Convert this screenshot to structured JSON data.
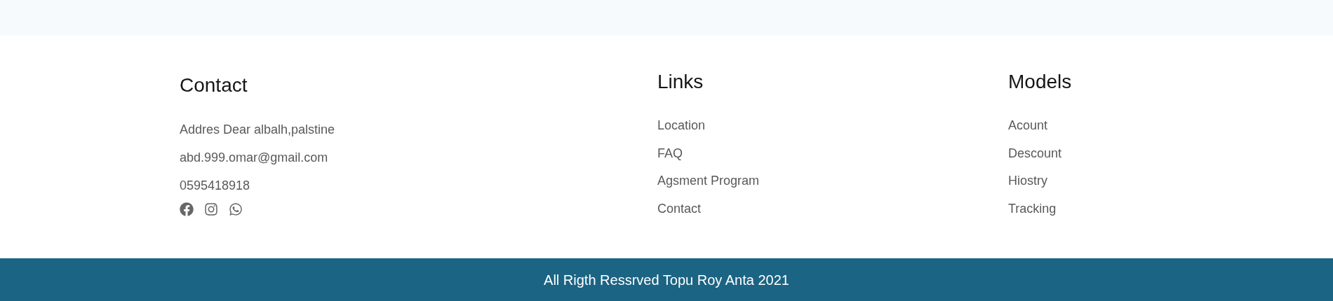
{
  "columns": [
    {
      "kind": "contact",
      "heading": "Contact",
      "items": [
        "Addres Dear albalh,palstine",
        "abd.999.omar@gmail.com",
        "0595418918"
      ],
      "social": [
        {
          "kind": "facebook"
        },
        {
          "kind": "instagram"
        },
        {
          "kind": "whatsapp"
        }
      ]
    },
    {
      "kind": "links",
      "heading": "Links",
      "items": [
        "Location",
        "FAQ",
        "Agsment Program",
        "Contact"
      ]
    },
    {
      "kind": "links",
      "heading": "Models",
      "items": [
        "Acount",
        "Descount",
        "Hiostry",
        "Tracking"
      ]
    }
  ],
  "footer_bar": {
    "text": "All Rigth Ressrved Topu Roy Anta 2021"
  }
}
